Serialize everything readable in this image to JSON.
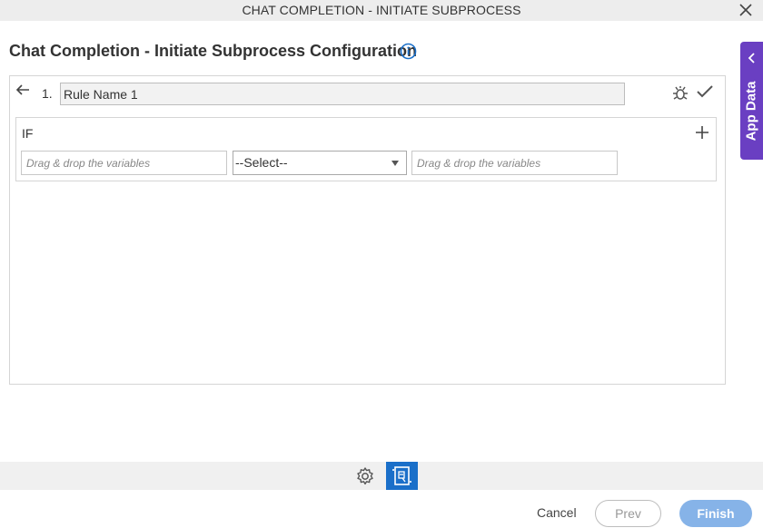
{
  "window": {
    "title": "CHAT COMPLETION - INITIATE SUBPROCESS",
    "close_icon": "close-icon"
  },
  "page": {
    "heading": "Chat Completion - Initiate Subprocess Configuration",
    "info_icon": "info-icon"
  },
  "side_panel": {
    "label": "App Data",
    "icon": "chevron-left-icon",
    "color": "#6a3fc2"
  },
  "rule": {
    "number": "1.",
    "name_value": "Rule Name 1",
    "back_icon": "arrow-left-icon",
    "debug_icon": "bug-icon",
    "confirm_icon": "check-icon",
    "condition": {
      "label": "IF",
      "add_icon": "plus-icon",
      "left_operand_placeholder": "Drag & drop the variables",
      "operator_selected": "--Select--",
      "right_operand_placeholder": "Drag & drop the variables"
    }
  },
  "toolbar": {
    "settings_icon": "gear-icon",
    "document_icon": "document-icon",
    "active_color": "#1a6fc9"
  },
  "footer": {
    "cancel_label": "Cancel",
    "prev_label": "Prev",
    "finish_label": "Finish",
    "finish_color": "#86b3e8"
  }
}
